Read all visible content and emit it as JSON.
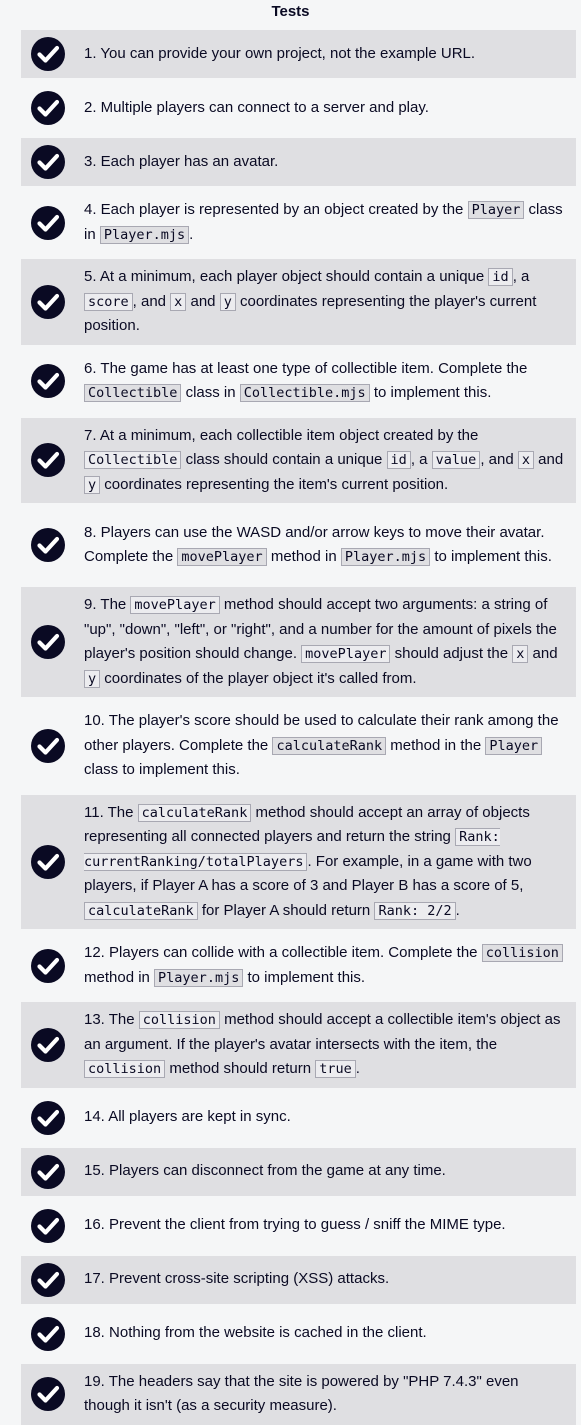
{
  "title": "Tests",
  "colors": {
    "check_circle": "#0a0a23",
    "odd_row": "#dfdfe2",
    "even_row": "#f5f6f7"
  },
  "icon": "check-circle-icon",
  "tests": [
    {
      "segments": [
        {
          "text": "1. You can provide your own project, not the example URL."
        }
      ]
    },
    {
      "segments": [
        {
          "text": "2. Multiple players can connect to a server and play."
        }
      ]
    },
    {
      "segments": [
        {
          "text": "3. Each player has an avatar."
        }
      ]
    },
    {
      "segments": [
        {
          "text": "4. Each player is represented by an object created by the "
        },
        {
          "code": "Player"
        },
        {
          "text": " class in "
        },
        {
          "code": "Player.mjs"
        },
        {
          "text": "."
        }
      ]
    },
    {
      "segments": [
        {
          "text": "5. At a minimum, each player object should contain a unique "
        },
        {
          "code": "id"
        },
        {
          "text": ", a "
        },
        {
          "code": "score"
        },
        {
          "text": ", and "
        },
        {
          "code": "x"
        },
        {
          "text": " and "
        },
        {
          "code": "y"
        },
        {
          "text": " coordinates representing the player's current position."
        }
      ]
    },
    {
      "segments": [
        {
          "text": "6. The game has at least one type of collectible item. Complete the "
        },
        {
          "code": "Collectible"
        },
        {
          "text": " class in "
        },
        {
          "code": "Collectible.mjs"
        },
        {
          "text": " to implement this."
        }
      ]
    },
    {
      "segments": [
        {
          "text": "7. At a minimum, each collectible item object created by the "
        },
        {
          "code": "Collectible"
        },
        {
          "text": " class should contain a unique "
        },
        {
          "code": "id"
        },
        {
          "text": ", a "
        },
        {
          "code": "value"
        },
        {
          "text": ", and "
        },
        {
          "code": "x"
        },
        {
          "text": " and "
        },
        {
          "code": "y"
        },
        {
          "text": " coordinates representing the item's current position."
        }
      ]
    },
    {
      "segments": [
        {
          "text": "8. Players can use the WASD and/or arrow keys to move their avatar. Complete the "
        },
        {
          "code": "movePlayer"
        },
        {
          "text": " method in "
        },
        {
          "code": "Player.mjs"
        },
        {
          "text": " to implement this."
        }
      ]
    },
    {
      "segments": [
        {
          "text": "9. The "
        },
        {
          "code": "movePlayer"
        },
        {
          "text": " method should accept two arguments: a string of \"up\", \"down\", \"left\", or \"right\", and a number for the amount of pixels the player's position should change. "
        },
        {
          "code": "movePlayer"
        },
        {
          "text": " should adjust the "
        },
        {
          "code": "x"
        },
        {
          "text": " and "
        },
        {
          "code": "y"
        },
        {
          "text": " coordinates of the player object it's called from."
        }
      ]
    },
    {
      "segments": [
        {
          "text": "10. The player's score should be used to calculate their rank among the other players. Complete the "
        },
        {
          "code": "calculateRank"
        },
        {
          "text": " method in the "
        },
        {
          "code": "Player"
        },
        {
          "text": " class to implement this."
        }
      ]
    },
    {
      "segments": [
        {
          "text": "11. The "
        },
        {
          "code": "calculateRank"
        },
        {
          "text": " method should accept an array of objects representing all connected players and return the string "
        },
        {
          "code": "Rank: currentRanking/totalPlayers"
        },
        {
          "text": ". For example, in a game with two players, if Player A has a score of 3 and Player B has a score of 5, "
        },
        {
          "code": "calculateRank"
        },
        {
          "text": " for Player A should return "
        },
        {
          "code": "Rank: 2/2"
        },
        {
          "text": "."
        }
      ]
    },
    {
      "segments": [
        {
          "text": "12. Players can collide with a collectible item. Complete the "
        },
        {
          "code": "collision"
        },
        {
          "text": " method in "
        },
        {
          "code": "Player.mjs"
        },
        {
          "text": " to implement this."
        }
      ]
    },
    {
      "segments": [
        {
          "text": "13. The "
        },
        {
          "code": "collision"
        },
        {
          "text": " method should accept a collectible item's object as an argument. If the player's avatar intersects with the item, the "
        },
        {
          "code": "collision"
        },
        {
          "text": " method should return "
        },
        {
          "code": "true"
        },
        {
          "text": "."
        }
      ]
    },
    {
      "segments": [
        {
          "text": "14. All players are kept in sync."
        }
      ]
    },
    {
      "segments": [
        {
          "text": "15. Players can disconnect from the game at any time."
        }
      ]
    },
    {
      "segments": [
        {
          "text": "16. Prevent the client from trying to guess / sniff the MIME type."
        }
      ]
    },
    {
      "segments": [
        {
          "text": "17. Prevent cross-site scripting (XSS) attacks."
        }
      ]
    },
    {
      "segments": [
        {
          "text": "18. Nothing from the website is cached in the client."
        }
      ]
    },
    {
      "segments": [
        {
          "text": "19. The headers say that the site is powered by \"PHP 7.4.3\" even though it isn't (as a security measure)."
        }
      ]
    }
  ]
}
